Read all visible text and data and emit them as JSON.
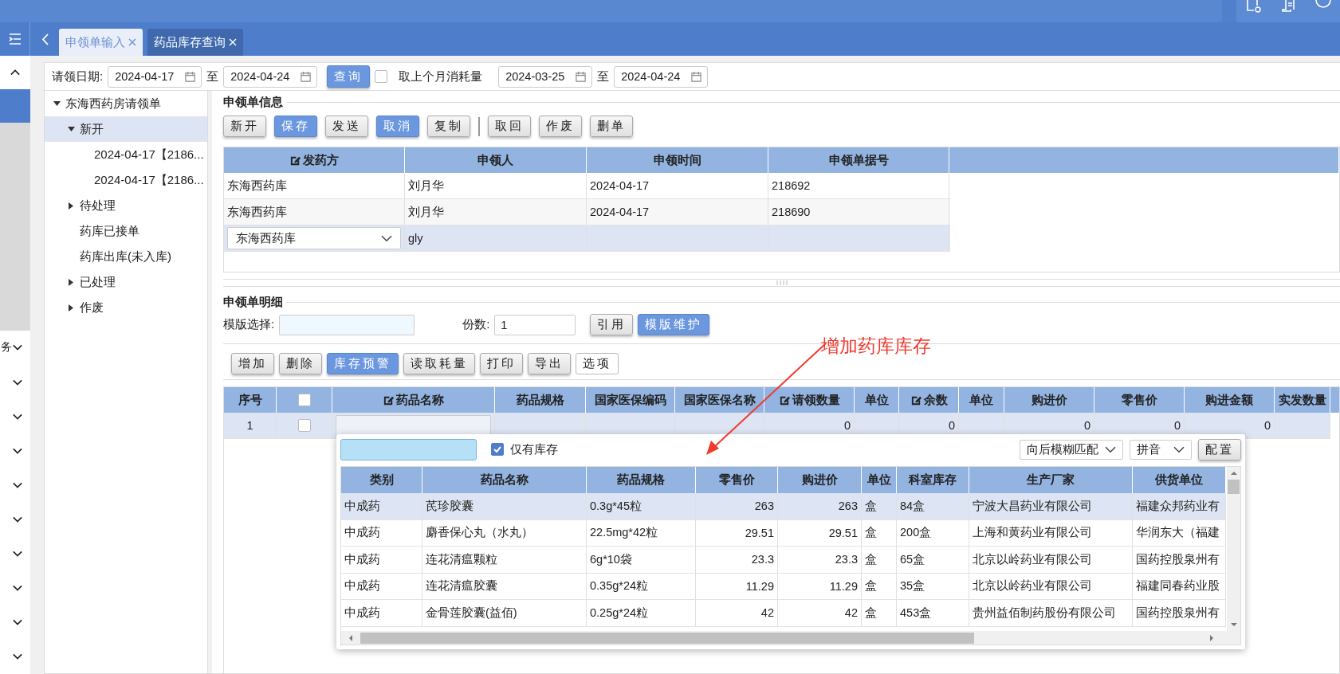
{
  "tabs": [
    {
      "label": "申领单输入",
      "selected": true
    },
    {
      "label": "药品库存查询",
      "selected": false
    }
  ],
  "rail": {
    "items": [
      {
        "label": "务",
        "expanded": false
      },
      {
        "expanded": false
      },
      {
        "expanded": false
      },
      {
        "expanded": false
      },
      {
        "expanded": false
      },
      {
        "expanded": false
      },
      {
        "expanded": false
      },
      {
        "expanded": false
      },
      {
        "expanded": false
      },
      {
        "expanded": false
      }
    ]
  },
  "query": {
    "label": "请领日期:",
    "from": "2024-04-17",
    "to_label": "至",
    "to": "2024-04-24",
    "button": "查询",
    "consumption": {
      "label": "取上个月消耗量",
      "checked": false
    },
    "consumption_from": "2024-03-25",
    "consumption_to_label": "至",
    "consumption_to": "2024-04-24"
  },
  "tree": [
    {
      "label": "东海西药房请领单",
      "expanded": true,
      "selected": false,
      "children": [
        {
          "label": "新开",
          "expanded": true,
          "selected": true,
          "children": [
            {
              "label": "2024-04-17【2186...",
              "selected": false
            },
            {
              "label": "2024-04-17【2186...",
              "selected": false
            }
          ]
        },
        {
          "label": "待处理",
          "expanded": false,
          "selected": false
        },
        {
          "label": "药库已接单",
          "selected": false
        },
        {
          "label": "药库出库(未入库)",
          "selected": false
        },
        {
          "label": "已处理",
          "expanded": false,
          "selected": false
        },
        {
          "label": "作废",
          "expanded": false,
          "selected": false
        }
      ]
    }
  ],
  "info": {
    "title": "申领单信息",
    "toolbar": [
      [
        {
          "label": "新开",
          "kind": "default"
        },
        {
          "label": "保存",
          "kind": "primary"
        },
        {
          "label": "发送",
          "kind": "default"
        },
        {
          "label": "取消",
          "kind": "primary"
        },
        {
          "label": "复制",
          "kind": "default"
        }
      ],
      [
        {
          "label": "取回",
          "kind": "default"
        },
        {
          "label": "作废",
          "kind": "default"
        },
        {
          "label": "删单",
          "kind": "default"
        }
      ]
    ],
    "columns": [
      {
        "label": "发药方",
        "editable": true
      },
      {
        "label": "申领人",
        "editable": false
      },
      {
        "label": "申领时间",
        "editable": false
      },
      {
        "label": "申领单据号",
        "editable": false
      }
    ],
    "rows": [
      {
        "kind": "data",
        "selected": false,
        "cells": [
          "东海西药库",
          "刘月华",
          "2024-04-17",
          "218692"
        ]
      },
      {
        "kind": "data",
        "selected": false,
        "cells": [
          "东海西药库",
          "刘月华",
          "2024-04-17",
          "218690"
        ]
      },
      {
        "kind": "edit",
        "selected": true,
        "cells": [
          "东海西药库",
          "gly"
        ]
      }
    ]
  },
  "detail": {
    "title": "申领单明细",
    "template": {
      "label": "模版选择:"
    },
    "copies": {
      "label": "份数:",
      "value": "1"
    },
    "template_buttons": [
      {
        "label": "引用",
        "kind": "default"
      },
      {
        "label": "模版维护",
        "kind": "primary"
      }
    ],
    "toolbar": [
      {
        "label": "增加",
        "kind": "default"
      },
      {
        "label": "删除",
        "kind": "default"
      },
      {
        "label": "库存预警",
        "kind": "primary"
      },
      {
        "label": "读取耗量",
        "kind": "default"
      },
      {
        "label": "打印",
        "kind": "default"
      },
      {
        "label": "导出",
        "kind": "default"
      },
      {
        "label": "选项",
        "kind": "plain"
      }
    ],
    "columns": [
      {
        "kind": "text",
        "label": "序号",
        "editable": false
      },
      {
        "kind": "checkbox",
        "checked": false
      },
      {
        "kind": "input",
        "label": "药品名称",
        "editable": true
      },
      {
        "kind": "text",
        "label": "药品规格",
        "editable": false
      },
      {
        "kind": "text",
        "label": "国家医保编码",
        "editable": false
      },
      {
        "kind": "text",
        "label": "国家医保名称",
        "editable": false
      },
      {
        "kind": "text",
        "label": "请领数量",
        "editable": true
      },
      {
        "kind": "text",
        "label": "单位",
        "editable": false
      },
      {
        "kind": "text",
        "label": "余数",
        "editable": true
      },
      {
        "kind": "text",
        "label": "单位",
        "editable": false
      },
      {
        "kind": "text",
        "label": "购进价",
        "editable": false
      },
      {
        "kind": "text",
        "label": "零售价",
        "editable": false
      },
      {
        "kind": "text",
        "label": "购进金额",
        "editable": false
      },
      {
        "kind": "text",
        "label": "实发数量",
        "editable": false
      }
    ],
    "rows": [
      {
        "selected": true,
        "index": "1",
        "checked": false,
        "values": [
          "0",
          "0",
          "0",
          "0",
          "0"
        ]
      }
    ]
  },
  "popup": {
    "only_stock": {
      "label": "仅有库存",
      "checked": true
    },
    "match": {
      "value": "向后模糊匹配"
    },
    "input_mode": {
      "value": "拼音"
    },
    "config_button": "配置",
    "columns": [
      "类别",
      "药品名称",
      "药品规格",
      "零售价",
      "购进价",
      "单位",
      "科室库存",
      "生产厂家",
      "供货单位"
    ],
    "rows": [
      {
        "selected": true,
        "cells": [
          "中成药",
          "芪珍胶囊",
          "0.3g*45粒",
          "263",
          "263",
          "盒",
          "84盒",
          "宁波大昌药业有限公司",
          "福建众邦药业有"
        ]
      },
      {
        "selected": false,
        "cells": [
          "中成药",
          "麝香保心丸（水丸）",
          "22.5mg*42粒",
          "29.51",
          "29.51",
          "盒",
          "200盒",
          "上海和黄药业有限公司",
          "华润东大（福建"
        ]
      },
      {
        "selected": false,
        "cells": [
          "中成药",
          "连花清瘟颗粒",
          "6g*10袋",
          "23.3",
          "23.3",
          "盒",
          "65盒",
          "北京以岭药业有限公司",
          "国药控股泉州有"
        ]
      },
      {
        "selected": false,
        "cells": [
          "中成药",
          "连花清瘟胶囊",
          "0.35g*24粒",
          "11.29",
          "11.29",
          "盒",
          "35盒",
          "北京以岭药业有限公司",
          "福建同春药业股"
        ]
      },
      {
        "selected": false,
        "cells": [
          "中成药",
          "金骨莲胶囊(益佰)",
          "0.25g*24粒",
          "42",
          "42",
          "盒",
          "453盒",
          "贵州益佰制药股份有限公司",
          "国药控股泉州有"
        ]
      }
    ]
  },
  "annotation": {
    "text": "增加药库库存"
  }
}
